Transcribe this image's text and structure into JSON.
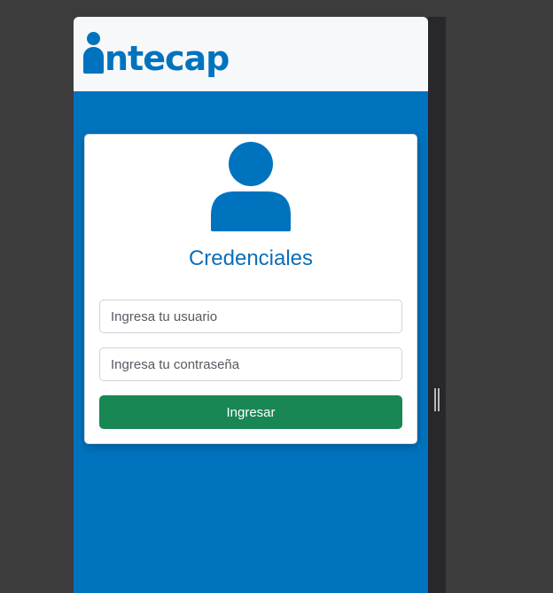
{
  "brand": {
    "name": "ntecap",
    "color": "#0073bf"
  },
  "login_card": {
    "title": "Credenciales",
    "icon": "user-icon",
    "username": {
      "placeholder": "Ingresa tu usuario",
      "value": ""
    },
    "password": {
      "placeholder": "Ingresa tu contraseña",
      "value": ""
    },
    "submit_label": "Ingresar"
  },
  "colors": {
    "primary": "#0073bf",
    "submit_button": "#198754",
    "header_bg": "#f7f8fa",
    "page_bg": "#3c3c3c"
  }
}
